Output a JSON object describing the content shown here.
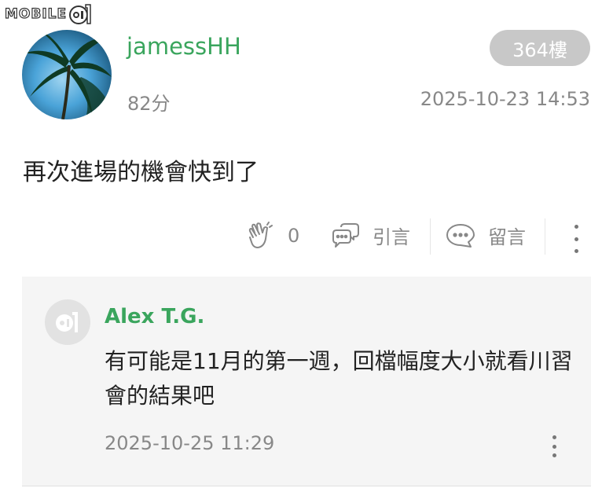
{
  "site": {
    "logo_text": "MOBILE"
  },
  "post": {
    "username": "jamessHH",
    "score": "82分",
    "floor": "364樓",
    "timestamp": "2025-10-23 14:53",
    "body": "再次進場的機會快到了",
    "actions": {
      "like_count": "0",
      "quote_label": "引言",
      "comment_label": "留言"
    }
  },
  "reply": {
    "username": "Alex T.G.",
    "body": "有可能是11月的第一週，回檔幅度大小就看川習會的結果吧",
    "timestamp": "2025-10-25 11:29"
  },
  "icons": [
    "mobile01-logo-icon",
    "clap-icon",
    "quote-icon",
    "comment-icon",
    "more-icon",
    "default-avatar-icon"
  ],
  "colors": {
    "accent_green": "#3aa55d",
    "muted_text": "#888888",
    "badge_bg": "#c8c8c8",
    "reply_bg": "#f5f5f5"
  }
}
